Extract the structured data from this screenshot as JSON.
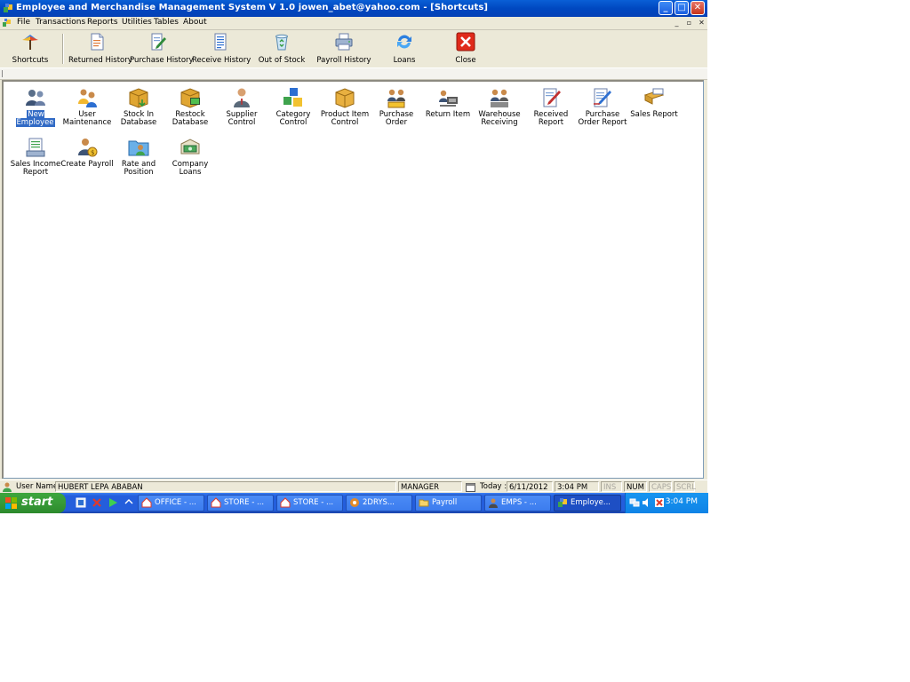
{
  "window": {
    "title": "Employee and Merchandise Management System V 1.0    jowen_abet@yahoo.com - [Shortcuts]",
    "controls": {
      "minimize": "_",
      "maximize": "□",
      "close": "✕"
    }
  },
  "menubar": {
    "items": [
      "File",
      "Transactions",
      "Reports",
      "Utilities",
      "Tables",
      "About"
    ],
    "child_controls": {
      "minimize": "_",
      "restore": "▫",
      "close": "✕"
    }
  },
  "toolbar": {
    "items": [
      {
        "label": "Shortcuts",
        "icon": "shortcuts-icon"
      },
      {
        "label": "Returned History",
        "icon": "document-icon"
      },
      {
        "label": "Purchase History",
        "icon": "edit-document-icon"
      },
      {
        "label": "Receive History",
        "icon": "list-document-icon"
      },
      {
        "label": "Out of Stock",
        "icon": "recycle-bin-icon"
      },
      {
        "label": "Payroll History",
        "icon": "printer-icon"
      },
      {
        "label": "Loans",
        "icon": "refresh-icon"
      },
      {
        "label": "Close",
        "icon": "close-icon"
      }
    ]
  },
  "shortcuts": {
    "items": [
      {
        "label": "New Employee",
        "icon": "new-employee-icon",
        "selected": true
      },
      {
        "label": "User Maintenance",
        "icon": "user-maintenance-icon"
      },
      {
        "label": "Stock In Database",
        "icon": "stock-in-database-icon"
      },
      {
        "label": "Restock Database",
        "icon": "restock-database-icon"
      },
      {
        "label": "Supplier Control",
        "icon": "supplier-icon"
      },
      {
        "label": "Category Control",
        "icon": "category-icon"
      },
      {
        "label": "Product Item Control",
        "icon": "product-item-icon"
      },
      {
        "label": "Purchase Order",
        "icon": "purchase-order-icon"
      },
      {
        "label": "Return Item",
        "icon": "return-item-icon"
      },
      {
        "label": "Warehouse Receiving",
        "icon": "warehouse-receiving-icon"
      },
      {
        "label": "Received Report",
        "icon": "received-report-icon"
      },
      {
        "label": "Purchase Order Report",
        "icon": "purchase-order-report-icon"
      },
      {
        "label": "Sales Report",
        "icon": "sales-report-icon"
      },
      {
        "label": "Sales Income Report",
        "icon": "sales-income-report-icon"
      },
      {
        "label": "Create Payroll",
        "icon": "create-payroll-icon"
      },
      {
        "label": "Rate and Position",
        "icon": "rate-position-icon"
      },
      {
        "label": "Company Loans",
        "icon": "company-loans-icon"
      }
    ]
  },
  "statusbar": {
    "user_label": "User Name :",
    "user_name": "HUBERT LEPA ABABAN",
    "role": "MANAGER",
    "date_label": "Today :",
    "date": "6/11/2012",
    "time": "3:04 PM",
    "ins": "INS",
    "num": "NUM",
    "caps": "CAPS",
    "scrl": "SCRL"
  },
  "taskbar": {
    "start_label": "start",
    "tasks": [
      {
        "label": "OFFICE - ...",
        "icon": "home-icon"
      },
      {
        "label": "STORE - ...",
        "icon": "home-icon"
      },
      {
        "label": "STORE - ...",
        "icon": "home-icon"
      },
      {
        "label": "2DRYS...",
        "icon": "app-icon"
      },
      {
        "label": "Payroll",
        "icon": "folder-icon"
      },
      {
        "label": "EMPS - ...",
        "icon": "app-icon"
      },
      {
        "label": "Employe...",
        "icon": "app-icon",
        "active": true
      }
    ],
    "clock": "3:04 PM"
  }
}
